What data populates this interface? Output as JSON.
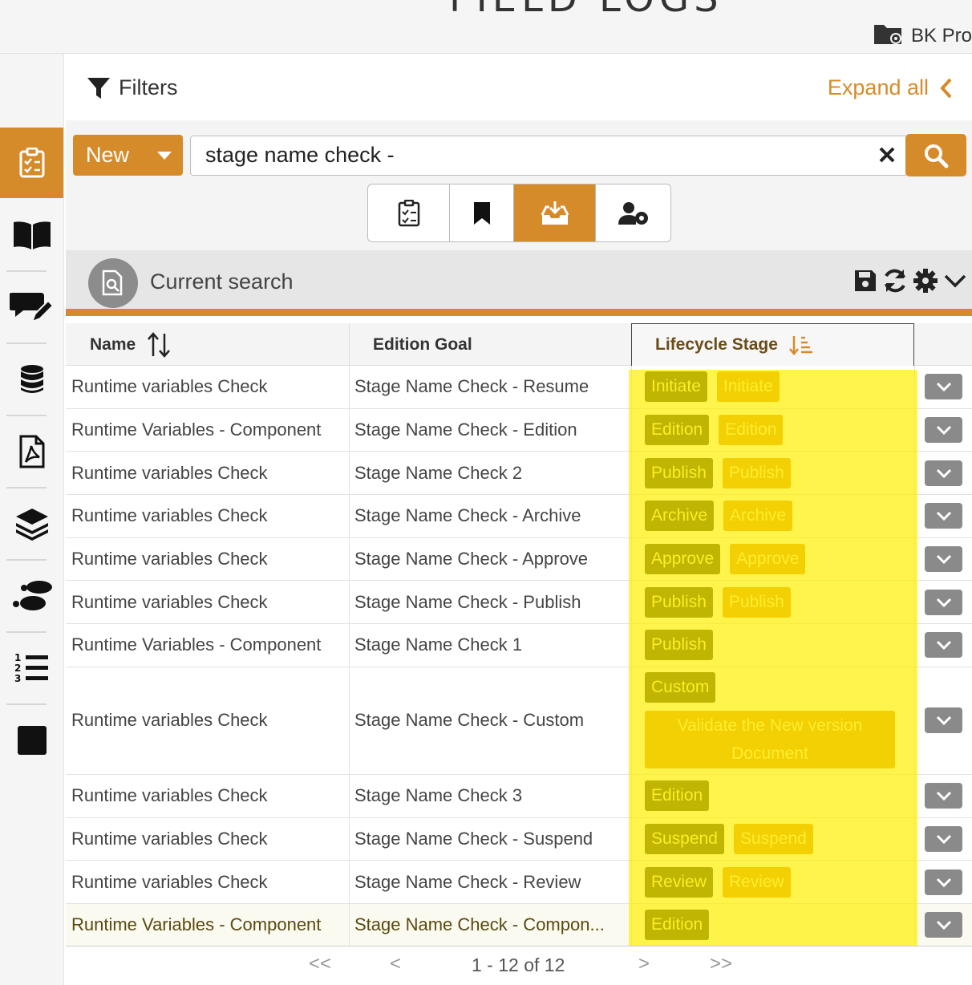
{
  "app": {
    "title": "FIELD LOGS",
    "project": "BK Pro"
  },
  "sidebar": {
    "items": [
      {
        "name": "clipboard-check-icon",
        "active": true
      },
      {
        "name": "book-icon",
        "active": false
      },
      {
        "name": "comment-edit-icon",
        "active": false
      },
      {
        "name": "database-icon",
        "active": false
      },
      {
        "name": "pdf-file-icon",
        "active": false
      },
      {
        "name": "layers-icon",
        "active": false
      },
      {
        "name": "footsteps-icon",
        "active": false
      },
      {
        "name": "numbered-list-icon",
        "active": false
      },
      {
        "name": "square-icon",
        "active": false
      }
    ]
  },
  "filters": {
    "label": "Filters",
    "expand_label": "Expand all"
  },
  "search": {
    "new_label": "New",
    "query": "stage name check -"
  },
  "view_tabs": [
    {
      "name": "tasks",
      "icon": "clipboard-check-icon",
      "active": false
    },
    {
      "name": "bookmarks",
      "icon": "bookmark-icon",
      "active": false
    },
    {
      "name": "inbox",
      "icon": "inbox-download-icon",
      "active": true
    },
    {
      "name": "user-settings",
      "icon": "user-cog-icon",
      "active": false
    }
  ],
  "current_search": {
    "label": "Current search"
  },
  "table": {
    "columns": {
      "name": "Name",
      "goal": "Edition Goal",
      "stage": "Lifecycle Stage"
    },
    "rows": [
      {
        "name": "Runtime variables Check",
        "goal": "Stage Name Check - Resume",
        "stages": [
          {
            "text": "Initiate",
            "style": "dark"
          },
          {
            "text": "Initiate",
            "style": "orange"
          }
        ]
      },
      {
        "name": "Runtime Variables - Component",
        "goal": "Stage Name Check - Edition",
        "stages": [
          {
            "text": "Edition",
            "style": "dark"
          },
          {
            "text": "Edition",
            "style": "orange"
          }
        ]
      },
      {
        "name": "Runtime variables Check",
        "goal": "Stage Name Check 2",
        "stages": [
          {
            "text": "Publish",
            "style": "dark"
          },
          {
            "text": "Publish",
            "style": "orange"
          }
        ]
      },
      {
        "name": "Runtime variables Check",
        "goal": "Stage Name Check - Archive",
        "stages": [
          {
            "text": "Archive",
            "style": "dark"
          },
          {
            "text": "Archive",
            "style": "orange"
          }
        ]
      },
      {
        "name": "Runtime variables Check",
        "goal": "Stage Name Check - Approve",
        "stages": [
          {
            "text": "Approve",
            "style": "dark"
          },
          {
            "text": "Approve",
            "style": "orange"
          }
        ]
      },
      {
        "name": "Runtime variables Check",
        "goal": "Stage Name Check - Publish",
        "stages": [
          {
            "text": "Publish",
            "style": "dark"
          },
          {
            "text": "Publish",
            "style": "orange"
          }
        ]
      },
      {
        "name": "Runtime Variables - Component",
        "goal": "Stage Name Check 1",
        "stages": [
          {
            "text": "Publish",
            "style": "dark"
          }
        ]
      },
      {
        "name": "Runtime variables Check",
        "goal": "Stage Name Check - Custom",
        "stages": [
          {
            "text": "Custom",
            "style": "dark"
          },
          {
            "text": "Validate the New version Document",
            "style": "orange wide"
          }
        ]
      },
      {
        "name": "Runtime variables Check",
        "goal": "Stage Name Check 3",
        "stages": [
          {
            "text": "Edition",
            "style": "dark"
          }
        ]
      },
      {
        "name": "Runtime variables Check",
        "goal": "Stage Name Check - Suspend",
        "stages": [
          {
            "text": "Suspend",
            "style": "dark"
          },
          {
            "text": "Suspend",
            "style": "orange"
          }
        ]
      },
      {
        "name": "Runtime variables Check",
        "goal": "Stage Name Check - Review",
        "stages": [
          {
            "text": "Review",
            "style": "dark"
          },
          {
            "text": "Review",
            "style": "orange"
          }
        ]
      },
      {
        "name": "Runtime Variables - Component",
        "goal": "Stage Name Check - Compon...",
        "stages": [
          {
            "text": "Edition",
            "style": "dark"
          }
        ]
      }
    ]
  },
  "pagination": {
    "text": "1 - 12 of 12",
    "first": "<<",
    "prev": "<",
    "next": ">",
    "last": ">>"
  },
  "colors": {
    "accent": "#d68b2a",
    "badge_dark": "#2e2e0c",
    "badge_orange": "#d5870e",
    "highlight": "#fff000"
  }
}
